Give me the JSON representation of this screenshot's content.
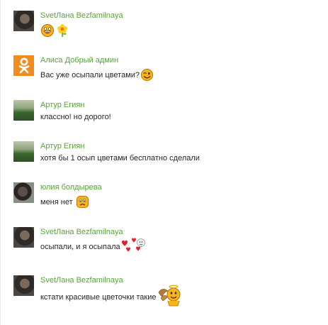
{
  "comments": [
    {
      "author": "SvetЛана Bezfamilnaya",
      "text": "",
      "avatar_icon": "user-photo",
      "emoticons": [
        "laughing-smiley-icon",
        "flower-icon"
      ]
    },
    {
      "author": "Алиса Добрый админ",
      "text": "Вас уже осыпали цветами?",
      "avatar_icon": "odnoklassniki-logo-icon",
      "emoticons": [
        "winking-smiley-icon"
      ]
    },
    {
      "author": "Артур Егиян",
      "text": "классно! но дорого!",
      "avatar_icon": "user-photo",
      "emoticons": []
    },
    {
      "author": "Артур Егиян",
      "text": "хотя бы 1 осып цветами бесплатно сделали",
      "avatar_icon": "user-photo",
      "emoticons": []
    },
    {
      "author": "юлия болдырева",
      "text": "меня нет",
      "avatar_icon": "user-photo",
      "emoticons": [
        "sad-smiley-icon"
      ]
    },
    {
      "author": "SvetЛана Bezfamilnaya",
      "text": "осыпали, и я осыпала",
      "avatar_icon": "user-photo",
      "emoticons": [
        "hearts-smiley-icon"
      ]
    },
    {
      "author": "SvetЛана Bezfamilnaya",
      "text": "кстати красивые цветочки такие",
      "avatar_icon": "user-photo",
      "emoticons": [
        "angel-smiley-icon"
      ]
    }
  ],
  "colors": {
    "author_link": "#58a33a",
    "text": "#262626",
    "ok_brand": "#f28b1d",
    "smiley_yellow": "#f7b516"
  }
}
